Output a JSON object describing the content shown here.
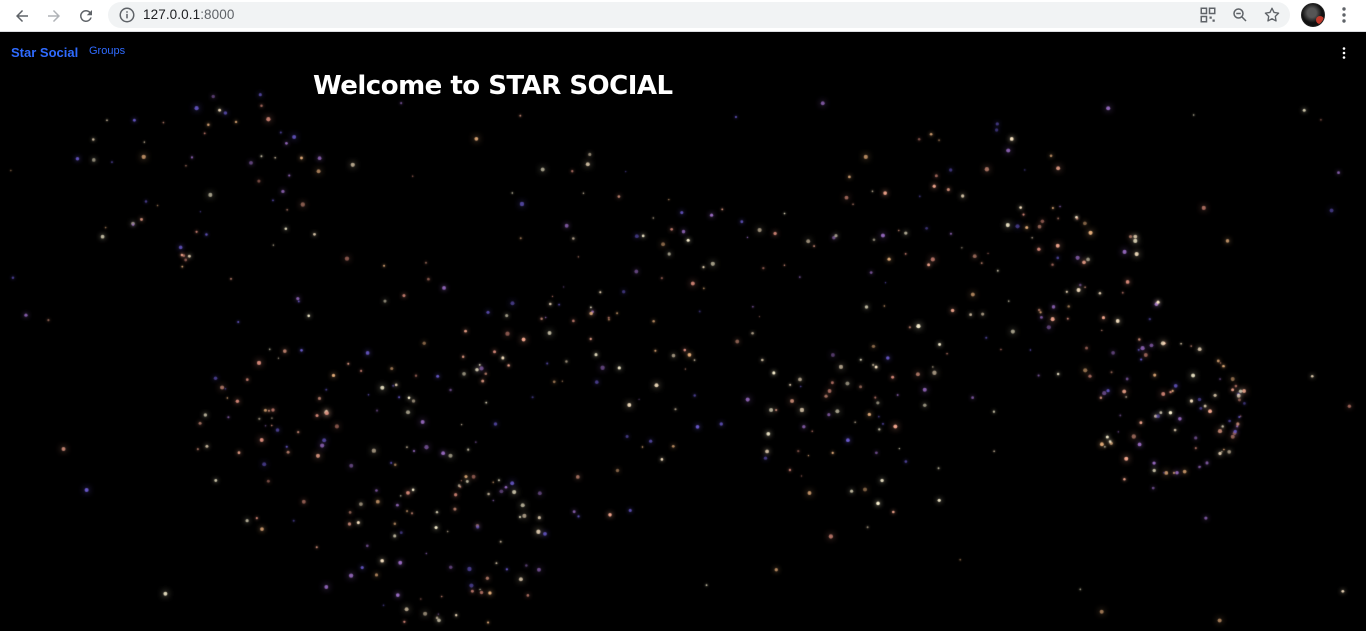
{
  "browser": {
    "url_host": "127.0.0.1",
    "url_port": ":8000",
    "icons": [
      "back-icon",
      "forward-icon",
      "reload-icon",
      "info-icon",
      "qr-code-icon",
      "zoom-out-icon",
      "bookmark-star-icon",
      "profile-avatar",
      "browser-menu-icon"
    ]
  },
  "navbar": {
    "brand": "Star Social",
    "links": [
      "Groups"
    ],
    "menu_icon": "vertical-dots-icon"
  },
  "main": {
    "heading": "Welcome to STAR SOCIAL"
  },
  "theme": {
    "background": "#000000",
    "link_color": "#2f6bff",
    "heading_color": "#ffffff"
  }
}
